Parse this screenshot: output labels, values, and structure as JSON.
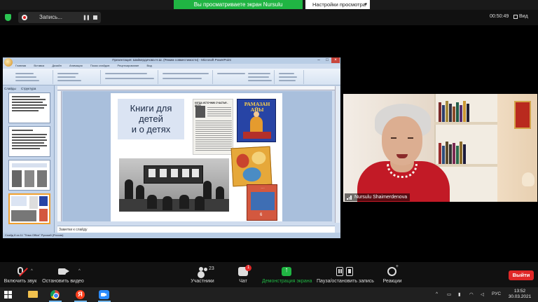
{
  "share_banner": {
    "viewing_text": "Вы просматриваете экран Nursulu Shaimerdenova",
    "options_label": "Настройки просмотра"
  },
  "top_bar": {
    "recording_label": "Запись...",
    "timer": "00:50:49",
    "view_label": "Вид"
  },
  "shared_screen": {
    "window_title": "Презентация: Шайкердичова Н.Ш. (Режим совместимости) - Microsoft PowerPoint",
    "ribbon_tabs": [
      "Главная",
      "Вставка",
      "Дизайн",
      "Анимация",
      "Показ слайдов",
      "Рецензирование",
      "Вид"
    ],
    "pane_tabs": [
      "Слайды",
      "Структура"
    ],
    "notes_placeholder": "Заметки к слайду",
    "status_left": "Слайд 8 из 11    \"Тема Office\"    Русский (Россия)",
    "slide": {
      "title_line1": "Книги для",
      "title_line2": "детей",
      "title_line3": "и о детях",
      "newspaper_headline": "КОГДА ИСТОЧНИК СЧАСТЬЯ - ДЕТИ",
      "book1_title_line1": "РАМАЗАН",
      "book1_title_line2": "АЙЫ",
      "book3_number": "6"
    }
  },
  "webcam": {
    "participant_name": "Nursulu Shaimerdenova"
  },
  "controls": {
    "mute_label": "Включить звук",
    "video_label": "Остановить видео",
    "participants_label": "Участники",
    "participants_count": "23",
    "chat_label": "Чат",
    "chat_badge": "1",
    "share_label": "Демонстрация экрана",
    "pause_record_label": "Пауза/остановить запись",
    "reactions_label": "Реакции",
    "leave_label": "Выйти"
  },
  "taskbar": {
    "language": "РУС",
    "time": "13:52",
    "date": "30.03.2021"
  },
  "colors": {
    "share_green": "#20b543",
    "leave_red": "#e02828",
    "shield_green": "#2bc552"
  }
}
